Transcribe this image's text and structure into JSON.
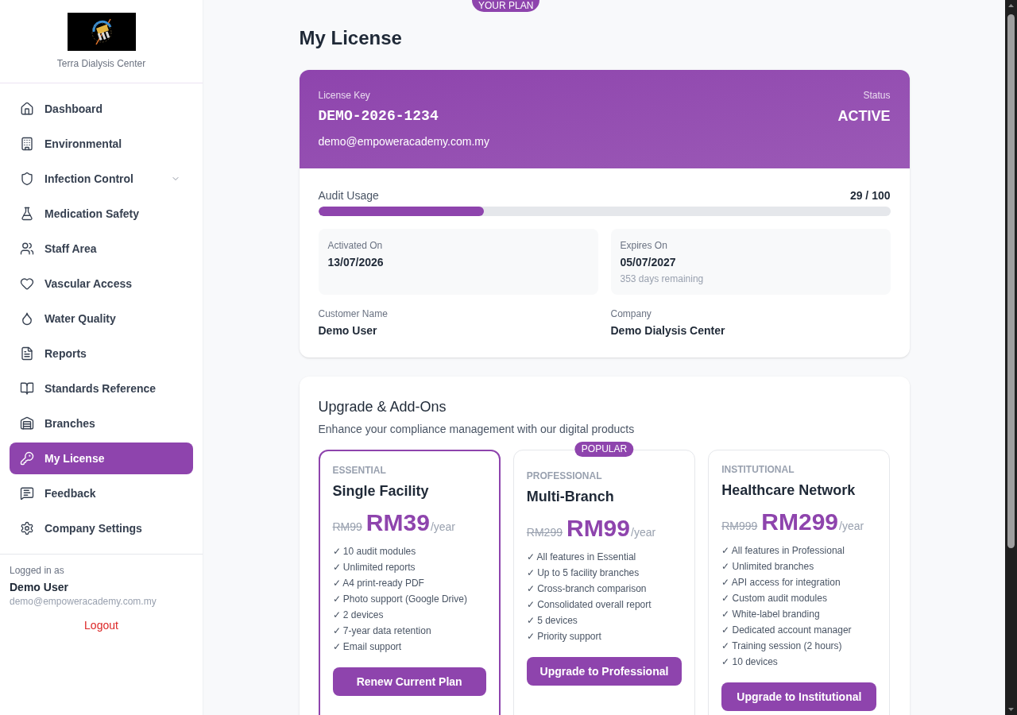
{
  "sidebar": {
    "brand": "Terra Dialysis Center",
    "items": [
      {
        "label": "Dashboard",
        "kind": "link",
        "selected": false
      },
      {
        "label": "Environmental",
        "kind": "link",
        "selected": false
      },
      {
        "label": "Infection Control",
        "kind": "group",
        "expanded": false,
        "selected": false
      },
      {
        "label": "Medication Safety",
        "kind": "link",
        "selected": false
      },
      {
        "label": "Staff Area",
        "kind": "link",
        "selected": false
      },
      {
        "label": "Vascular Access",
        "kind": "link",
        "selected": false
      },
      {
        "label": "Water Quality",
        "kind": "link",
        "selected": false
      },
      {
        "label": "Reports",
        "kind": "link",
        "selected": false
      },
      {
        "label": "Standards Reference",
        "kind": "link",
        "selected": false
      },
      {
        "label": "Branches",
        "kind": "link",
        "selected": false
      },
      {
        "label": "My License",
        "kind": "link",
        "selected": true
      },
      {
        "label": "Feedback",
        "kind": "link",
        "selected": false
      },
      {
        "label": "Company Settings",
        "kind": "link",
        "selected": false
      }
    ],
    "user": {
      "caption": "Logged in as",
      "name": "Demo User",
      "email": "demo@empoweracademy.com.my"
    },
    "logout": "Logout"
  },
  "floating_badge": "YOUR PLAN",
  "page_title": "My License",
  "license": {
    "key_label": "License Key",
    "key": "DEMO-2026-1234",
    "email": "demo@empoweracademy.com.my",
    "status_label": "Status",
    "status": "ACTIVE",
    "usage": {
      "label": "Audit Usage",
      "reading": "29 / 100",
      "level": 0.29
    },
    "dates": [
      {
        "label": "Activated On",
        "value": "13/07/2026"
      },
      {
        "label": "Expires On",
        "value": "05/07/2027",
        "note": "353 days remaining"
      }
    ],
    "details": [
      {
        "label": "Customer Name",
        "value": "Demo User"
      },
      {
        "label": "Company",
        "value": "Demo Dialysis Center"
      }
    ]
  },
  "upgrades": {
    "title": "Upgrade & Add-Ons",
    "subtitle": "Enhance your compliance management with our digital products",
    "plans": [
      {
        "tier": "ESSENTIAL",
        "name": "Single Facility",
        "old_price": "RM99",
        "price": "RM39",
        "period": "/year",
        "current": true,
        "features": [
          "✓ 10 audit modules",
          "✓ Unlimited reports",
          "✓ A4 print-ready PDF",
          "✓ Photo support (Google Drive)",
          "✓ 2 devices",
          "✓ 7-year data retention",
          "✓ Email support"
        ],
        "button": "Renew Current Plan"
      },
      {
        "badge": "POPULAR",
        "tier": "PROFESSIONAL",
        "name": "Multi-Branch",
        "old_price": "RM299",
        "price": "RM99",
        "period": "/year",
        "current": false,
        "features": [
          "✓ All features in Essential",
          "✓ Up to 5 facility branches",
          "✓ Cross-branch comparison",
          "✓ Consolidated overall report",
          "✓ 5 devices",
          "✓ Priority support"
        ],
        "button": "Upgrade to Professional"
      },
      {
        "tier": "INSTITUTIONAL",
        "name": "Healthcare Network",
        "old_price": "RM999",
        "price": "RM299",
        "period": "/year",
        "current": false,
        "features": [
          "✓ All features in Professional",
          "✓ Unlimited branches",
          "✓ API access for integration",
          "✓ Custom audit modules",
          "✓ White-label branding",
          "✓ Dedicated account manager",
          "✓ Training session (2 hours)",
          "✓ 10 devices"
        ],
        "button": "Upgrade to Institutional"
      }
    ]
  }
}
